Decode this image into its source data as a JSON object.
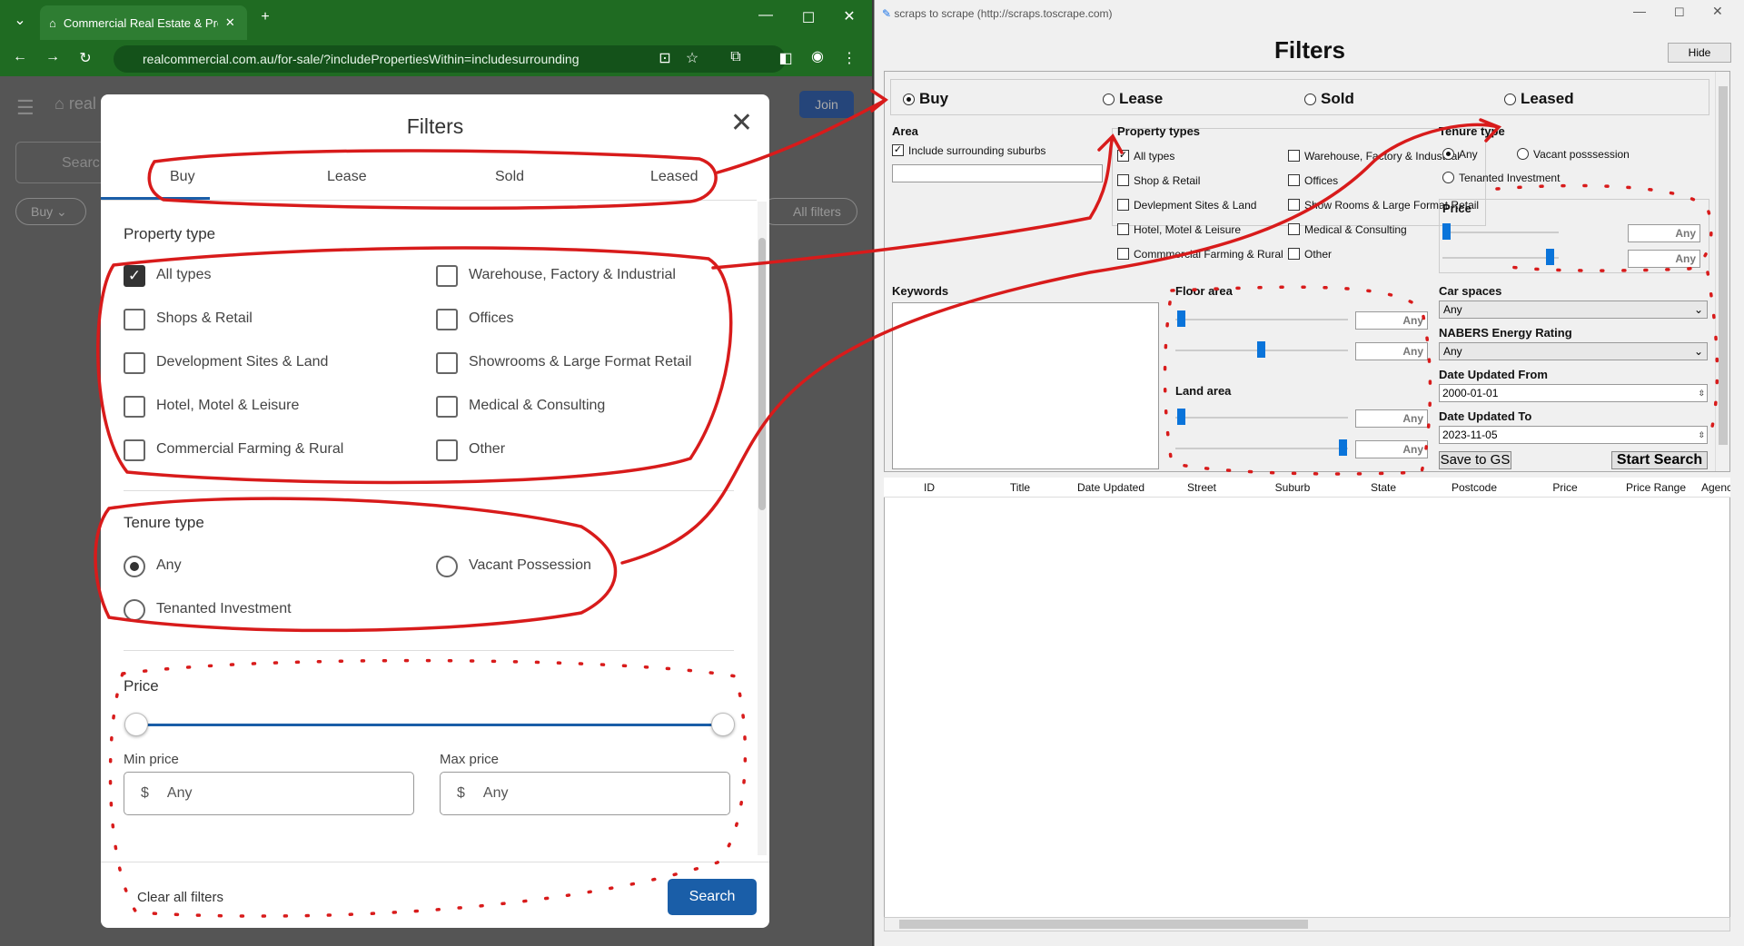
{
  "browser": {
    "tab_title": "Commercial Real Estate & Prop",
    "url": "realcommercial.com.au/for-sale/?includePropertiesWithin=includesurrounding",
    "page_bg_labels": {
      "search": "Searc",
      "buy_chip": "Buy",
      "all_filters": "All filters",
      "join": "Join",
      "logo": "real"
    }
  },
  "modal": {
    "title": "Filters",
    "tabs": [
      "Buy",
      "Lease",
      "Sold",
      "Leased"
    ],
    "property_type_heading": "Property type",
    "property_types": [
      {
        "label": "All types",
        "checked": true
      },
      {
        "label": "Warehouse, Factory & Industrial",
        "checked": false
      },
      {
        "label": "Shops & Retail",
        "checked": false
      },
      {
        "label": "Offices",
        "checked": false
      },
      {
        "label": "Development Sites & Land",
        "checked": false
      },
      {
        "label": "Showrooms & Large Format Retail",
        "checked": false
      },
      {
        "label": "Hotel, Motel & Leisure",
        "checked": false
      },
      {
        "label": "Medical & Consulting",
        "checked": false
      },
      {
        "label": "Commercial Farming & Rural",
        "checked": false
      },
      {
        "label": "Other",
        "checked": false
      }
    ],
    "tenure_heading": "Tenure type",
    "tenure": [
      {
        "label": "Any",
        "selected": true
      },
      {
        "label": "Vacant Possession",
        "selected": false
      },
      {
        "label": "Tenanted Investment",
        "selected": false
      }
    ],
    "price_heading": "Price",
    "min_price_label": "Min price",
    "max_price_label": "Max price",
    "currency": "$",
    "min_price": "Any",
    "max_price": "Any",
    "clear_label": "Clear all filters",
    "search_label": "Search"
  },
  "app": {
    "window_title": "scraps to scrape (http://scraps.toscrape.com)",
    "heading": "Filters",
    "hide_label": "Hide",
    "listing_types": [
      {
        "label": "Buy",
        "selected": true
      },
      {
        "label": "Lease",
        "selected": false
      },
      {
        "label": "Sold",
        "selected": false
      },
      {
        "label": "Leased",
        "selected": false
      }
    ],
    "area_label": "Area",
    "include_surrounding": "Include surrounding suburbs",
    "property_types_label": "Property types",
    "property_types": [
      {
        "label": "All types",
        "checked": true
      },
      {
        "label": "Warehouse, Factory & Industrial",
        "checked": false
      },
      {
        "label": "Shop & Retail",
        "checked": false
      },
      {
        "label": "Offices",
        "checked": false
      },
      {
        "label": "Devlepment Sites & Land",
        "checked": false
      },
      {
        "label": "Show Rooms & Large Format Retail",
        "checked": false
      },
      {
        "label": "Hotel, Motel & Leisure",
        "checked": false
      },
      {
        "label": "Medical & Consulting",
        "checked": false
      },
      {
        "label": "Commmercial Farming & Rural",
        "checked": false
      },
      {
        "label": "Other",
        "checked": false
      }
    ],
    "tenure_label": "Tenure type",
    "tenure": [
      {
        "label": "Any",
        "selected": true
      },
      {
        "label": "Vacant posssession",
        "selected": false
      },
      {
        "label": "Tenanted Investment",
        "selected": false
      }
    ],
    "price_label": "Price",
    "any": "Any",
    "keywords_label": "Keywords",
    "floor_area_label": "Floor area",
    "land_area_label": "Land area",
    "car_spaces_label": "Car spaces",
    "car_spaces_value": "Any",
    "nabers_label": "NABERS Energy Rating",
    "nabers_value": "Any",
    "date_from_label": "Date Updated From",
    "date_from": "2000-01-01",
    "date_to_label": "Date Updated To",
    "date_to": "2023-11-05",
    "save_label": "Save to GS",
    "start_label": "Start Search",
    "columns": [
      "ID",
      "Title",
      "Date Updated",
      "Street",
      "Suburb",
      "State",
      "Postcode",
      "Price",
      "Price Range",
      "Agenc"
    ]
  },
  "colors": {
    "brand_green": "#1f6b22",
    "primary_blue": "#1a5ea8",
    "annotation_red": "#d81b1b",
    "slider_blue": "#0a74da"
  }
}
